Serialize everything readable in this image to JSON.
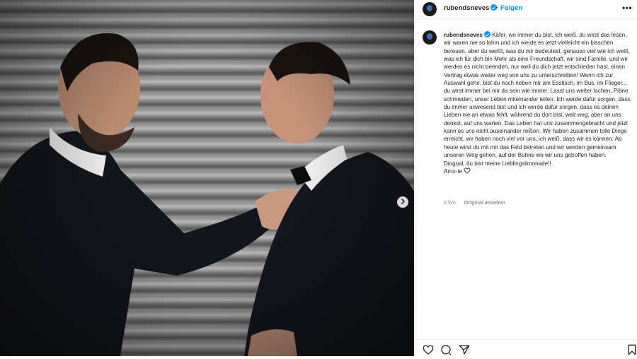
{
  "post": {
    "username": "rubendsneves",
    "dot": "•",
    "follow_label": "Folgen",
    "more_label": "•••",
    "caption": "Käfer, wo immer du bist, ich weiß, du wirst das lesen, wir waren nie so lahm und ich werde es jetzt vielleicht ein bisschen bereuen, aber du weißt, was du mir bedeutest, genauso viel wie ich weiß, was ich für dich bin Mehr als eine Freundschaft, wir sind Familie, und wir werden es nicht beenden, nur weil du dich jetzt entschieden hast, einen Vertrag etwas weiter weg von uns zu unterschreiben! Wenn ich zur Auswahl gehe, bist du noch neben mir am Esstisch, im Bus, im Flieger... du wirst immer bei mir da sein wie immer. Lasst uns weiter lachen, Pläne schmieden, unser Leben miteinander teilen. Ich werde dafür sorgen, dass du immer anwesend bist und ich werde dafür sorgen, dass es deinen Lieben nie an etwas fehlt, während du dort bist, weit weg, aber an uns denkst, auf uns warten. Das Leben hat uns zusammengebracht und jetzt kann es uns nicht auseinander reißen. Wir haben zusammen tolle Dinge erreicht, wir haben noch viel vor uns, ich weiß, dass wir es können. Ab heute wirst du mit mir das Feld betreten und wir werden gemeinsam unseren Weg gehen, auf der Bühne wo wir uns getroffen haben.",
    "caption_line2": "Diogoal, du bist meine Lieblingslimonade!!",
    "caption_line3": "Amo-te",
    "time_ago": "8 Wo.",
    "view_original": "Original ansehen"
  },
  "icons": {
    "verified": "verified-badge-icon",
    "next": "chevron-right-icon",
    "like": "heart-icon",
    "comment": "comment-icon",
    "share": "send-icon",
    "save": "bookmark-icon"
  },
  "colors": {
    "accent": "#0095f6",
    "text": "#262626",
    "muted": "#8e8e8e",
    "border": "#efefef"
  }
}
